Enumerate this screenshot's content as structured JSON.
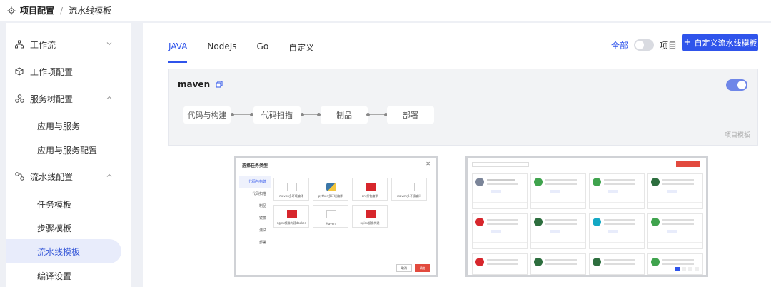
{
  "breadcrumb": {
    "icon": "gear-icon",
    "root": "项目配置",
    "current": "流水线模板"
  },
  "sidebar": {
    "groups": [
      {
        "label": "工作流",
        "icon": "org-chart-icon",
        "expanded": false
      },
      {
        "label": "工作项配置",
        "icon": "cube-icon"
      },
      {
        "label": "服务树配置",
        "icon": "cluster-icon",
        "expanded": true,
        "children": [
          "应用与服务",
          "应用与服务配置"
        ]
      },
      {
        "label": "流水线配置",
        "icon": "pipeline-icon",
        "expanded": true,
        "children": [
          "任务模板",
          "步骤模板",
          "流水线模板",
          "编译设置"
        ]
      }
    ],
    "active": "流水线模板"
  },
  "tabs": [
    "JAVA",
    "NodeJs",
    "Go",
    "自定义"
  ],
  "active_tab": "JAVA",
  "scope": {
    "all": "全部",
    "project": "项目"
  },
  "create_button": "自定义流水线模板",
  "template": {
    "name": "maven",
    "stages": [
      "代码与构建",
      "代码扫描",
      "制品",
      "部署"
    ],
    "tag": "项目模板",
    "enabled": true
  },
  "dialog_preview": {
    "title": "选择任务类型",
    "categories": [
      "代码与构建",
      "代码扫描",
      "制品",
      "镜像",
      "测试",
      "部署"
    ],
    "items": [
      "maven多环境编译",
      "python多环境编译",
      "ant打包编译",
      "maven多环境编译",
      "nginx镜像构建docker",
      "Maven",
      "nginx镜像构建"
    ],
    "cancel": "取消",
    "ok": "确定"
  },
  "colors": {
    "primary": "#2f54eb",
    "danger": "#e24a3e",
    "toggle_on": "#6f86e8"
  }
}
